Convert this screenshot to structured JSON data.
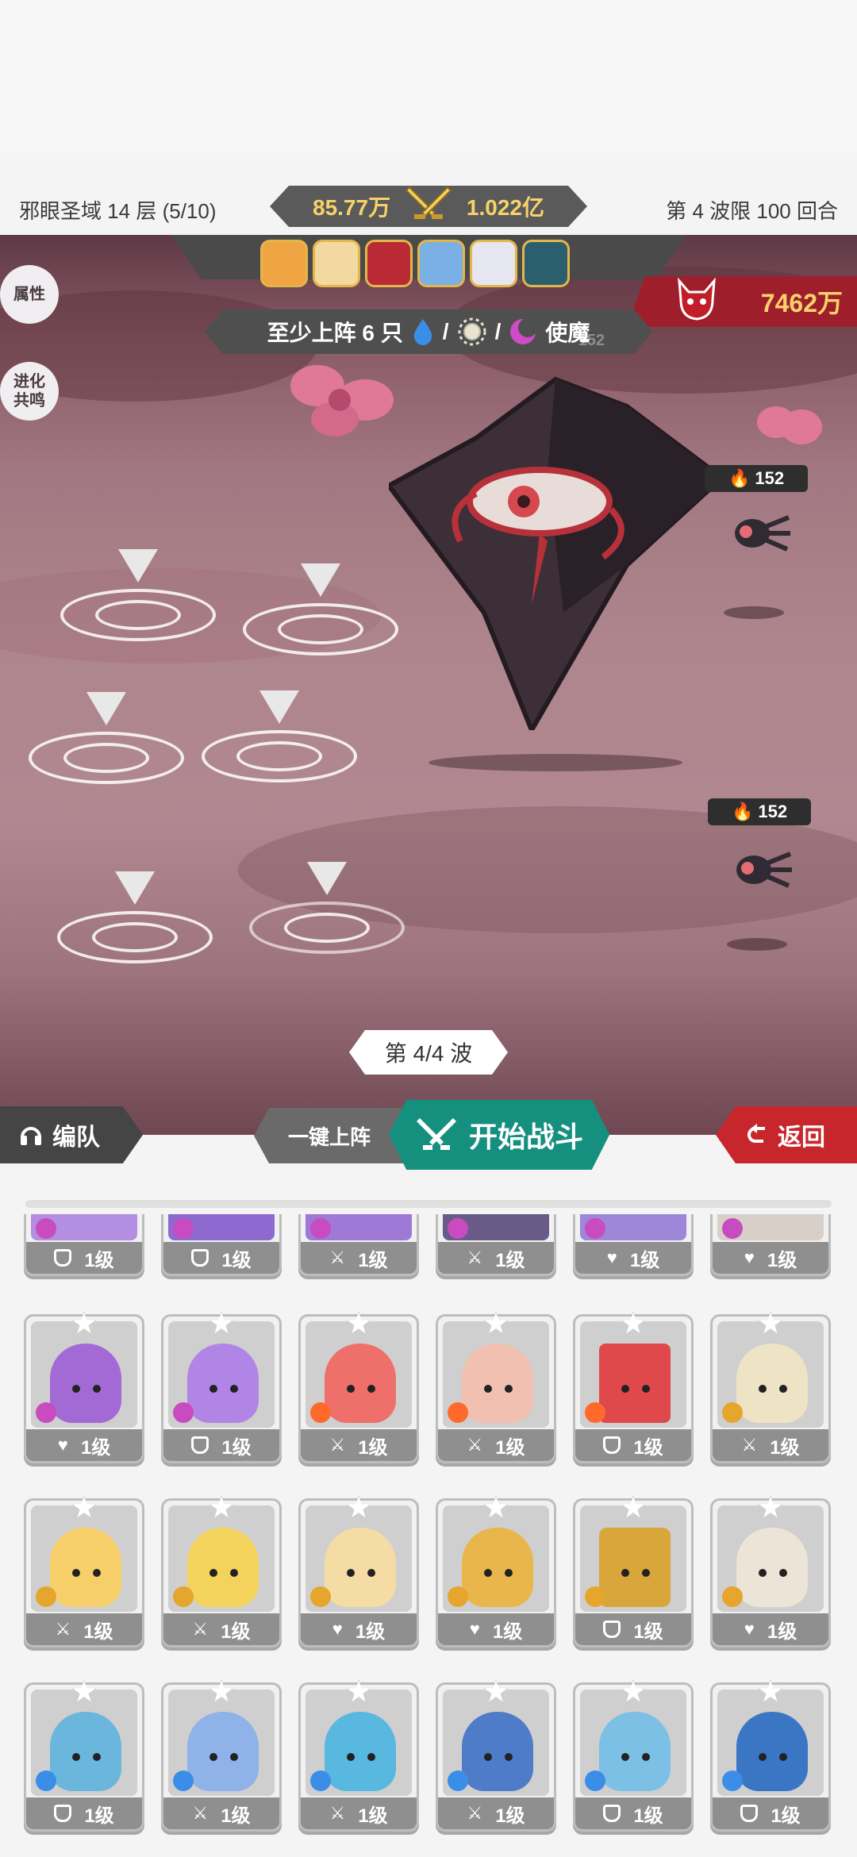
{
  "status": {
    "stage": "邪眼圣域 14 层 (5/10)",
    "power_left": "85.77万",
    "power_right": "1.022亿",
    "limit": "第 4 波限 100 回合"
  },
  "battle": {
    "requirement_text": "至少上阵 6 只",
    "requirement_tag": "使魔",
    "sep": "/",
    "enemy_power": "7462万",
    "faint_level": "152",
    "side_buttons": [
      {
        "label": "属性"
      },
      {
        "label": "进化\n共鸣"
      }
    ],
    "enemy_levels": [
      "152",
      "152"
    ],
    "wave": "第 4/4 波"
  },
  "controls": {
    "team_label": "编队",
    "auto_label": "一键上阵",
    "start_label": "开始战斗",
    "back_label": "返回"
  },
  "units": {
    "level_label": "1级"
  },
  "colors": {
    "accent_green": "#16907e",
    "back_red": "#c7262c",
    "gold": "#f7d36a"
  }
}
